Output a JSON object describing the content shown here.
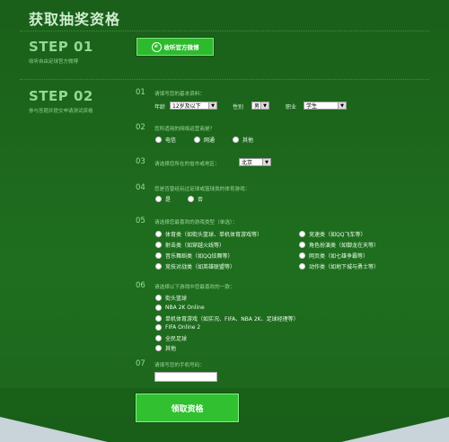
{
  "page_title": "获取抽奖资格",
  "step1": {
    "title": "STEP 01",
    "subtitle": "收听自由足球官方微博",
    "button_label": "收听官方微博"
  },
  "step2": {
    "title": "STEP 02",
    "subtitle": "参与答题并提交申请测试资格"
  },
  "q1": {
    "num": "01",
    "text": "请填写您的基本资料：",
    "age_label": "年龄",
    "age_value": "12岁及以下",
    "gender_label": "性别",
    "gender_value": "男",
    "job_label": "职业",
    "job_value": "学生"
  },
  "q2": {
    "num": "02",
    "text": "您所适用的网络运营商是？",
    "options": [
      "电信",
      "网通",
      "其他"
    ]
  },
  "q3": {
    "num": "03",
    "text": "请选择您所在的省市或地区：",
    "region_value": "北京"
  },
  "q4": {
    "num": "04",
    "text": "您是否曾经玩过足球或篮球类的体育游戏：",
    "options": [
      "是",
      "否"
    ]
  },
  "q5": {
    "num": "05",
    "text": "请选择您最喜欢的游戏类型（单选）：",
    "left": [
      "体育类（如街头篮球、单机体育游戏等）",
      "射击类（如穿越火线等）",
      "音乐舞蹈类（如QQ炫舞等）",
      "竞技对战类（如英雄联盟等）"
    ],
    "right": [
      "竞速类（如QQ飞车等）",
      "角色扮演类（如御龙在天等）",
      "网页类（如七雄争霸等）",
      "动作类（如地下城与勇士等）"
    ]
  },
  "q6": {
    "num": "06",
    "text": "请选择以下游戏中您最喜欢的一款：",
    "options": [
      "街头篮球",
      "NBA 2K Online",
      "单机体育游戏（如实况、FIFA、NBA 2K、足球经理等）",
      "FIFA Online 2",
      "全民足球",
      "其他"
    ]
  },
  "q7": {
    "num": "07",
    "text": "请填写您的手机号码：",
    "phone_value": ""
  },
  "submit_label": "领取资格",
  "colors": {
    "background": "#1e6a1e",
    "button": "#30c030",
    "accent_text": "#93d893"
  }
}
